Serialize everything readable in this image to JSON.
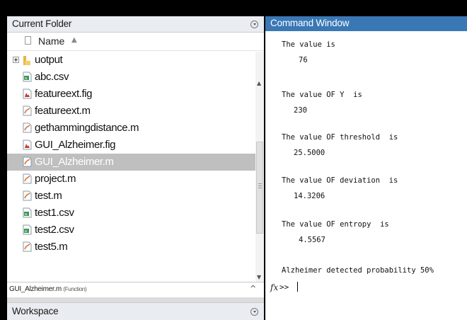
{
  "current_folder": {
    "title": "Current Folder",
    "column_header": "Name",
    "items": [
      {
        "name": "uotput",
        "type": "folder"
      },
      {
        "name": "abc.csv",
        "type": "csv"
      },
      {
        "name": "featureext.fig",
        "type": "fig"
      },
      {
        "name": "featureext.m",
        "type": "m"
      },
      {
        "name": "gethammingdistance.m",
        "type": "m"
      },
      {
        "name": "GUI_Alzheimer.fig",
        "type": "fig"
      },
      {
        "name": "GUI_Alzheimer.m",
        "type": "m",
        "selected": true
      },
      {
        "name": "project.m",
        "type": "m"
      },
      {
        "name": "test.m",
        "type": "m"
      },
      {
        "name": "test1.csv",
        "type": "csv"
      },
      {
        "name": "test2.csv",
        "type": "csv"
      },
      {
        "name": "test5.m",
        "type": "m"
      }
    ],
    "details": {
      "file": "GUI_Alzheimer.m",
      "kind": "(Function)"
    }
  },
  "workspace": {
    "title": "Workspace"
  },
  "command_window": {
    "title": "Command Window",
    "lines": [
      {
        "text": "The value is",
        "indent": false
      },
      {
        "text": "76",
        "indent": true
      },
      {
        "text": "The value OF Y  is",
        "indent": false
      },
      {
        "text": "230",
        "indent": true
      },
      {
        "text": "The value OF threshold  is",
        "indent": false
      },
      {
        "text": "25.5000",
        "indent": true
      },
      {
        "text": "The value OF deviation  is",
        "indent": false
      },
      {
        "text": "14.3206",
        "indent": true
      },
      {
        "text": "The value OF entropy  is",
        "indent": false
      },
      {
        "text": "4.5567",
        "indent": true
      },
      {
        "text": "Alzheimer detected probability 50%",
        "indent": false
      }
    ],
    "fx_symbol": "fx",
    "prompt": ">>"
  },
  "colors": {
    "panel_header": "#e9ecf0",
    "active_header": "#3a78b5",
    "selection": "#bfbfbf"
  }
}
